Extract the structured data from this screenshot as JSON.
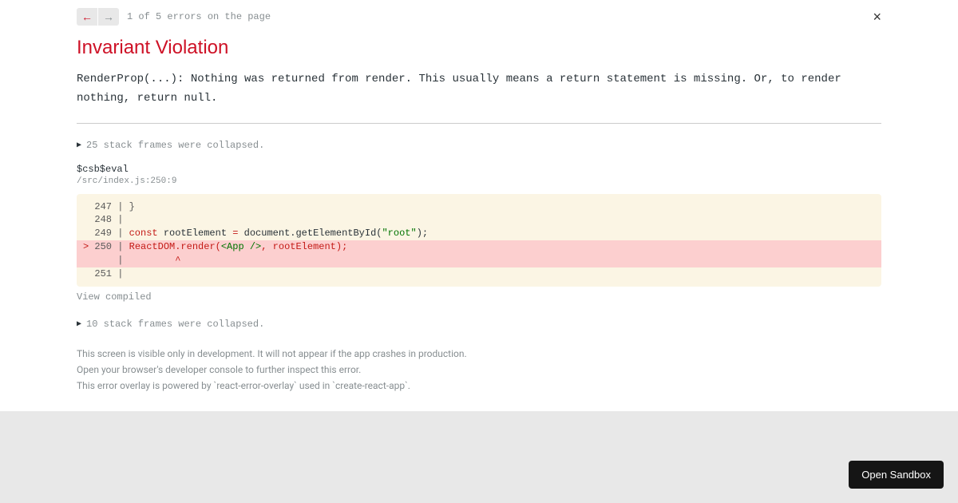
{
  "nav": {
    "prev_icon": "←",
    "next_icon": "→",
    "counter": "1 of 5 errors on the page",
    "close": "×"
  },
  "error": {
    "title": "Invariant Violation",
    "message": "RenderProp(...): Nothing was returned from render. This usually means a return statement is missing. Or, to render nothing, return null."
  },
  "stack": {
    "collapsed_top": "25 stack frames were collapsed.",
    "frame_name": "$csb$eval",
    "frame_location": "/src/index.js:250:9",
    "collapsed_bottom": "10 stack frames were collapsed."
  },
  "code": {
    "l247": "  247 | }",
    "l248": "  248 | ",
    "l249_gutter": "  249 | ",
    "l249_const": "const",
    "l249_mid": " rootElement ",
    "l249_eq": "=",
    "l249_rest": " document.getElementById(",
    "l249_str": "\"root\"",
    "l249_end": ");",
    "l250_marker": ">",
    "l250_gutter": " 250 | ",
    "l250_cls": "ReactDOM",
    "l250_render": ".render(",
    "l250_jsx": "<App />",
    "l250_end": ", rootElement);",
    "l250_caret_line": "      |         ",
    "l250_caret": "^",
    "l251": "  251 | "
  },
  "view_compiled": "View compiled",
  "footer": {
    "line1": "This screen is visible only in development. It will not appear if the app crashes in production.",
    "line2": "Open your browser's developer console to further inspect this error.",
    "line3": "This error overlay is powered by `react-error-overlay` used in `create-react-app`."
  },
  "sandbox_button": "Open Sandbox"
}
